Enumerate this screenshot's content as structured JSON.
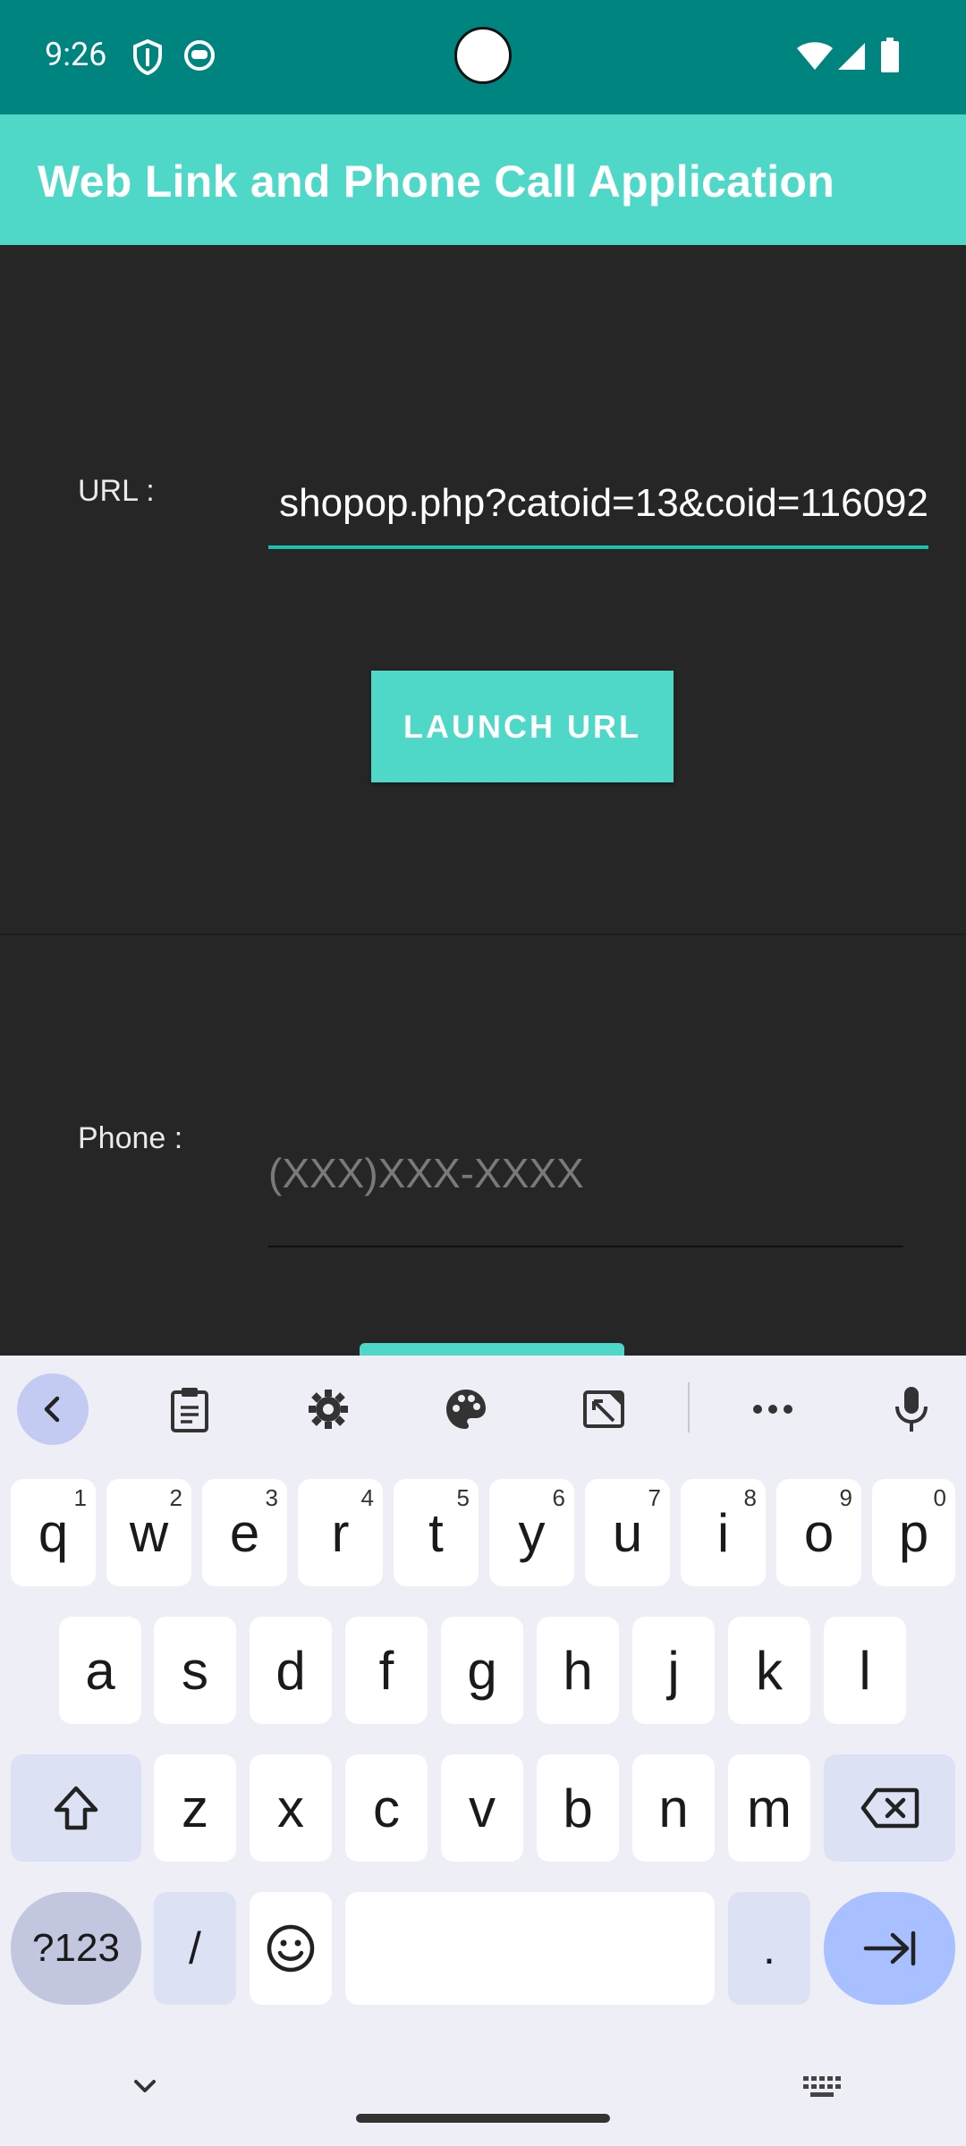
{
  "status_bar": {
    "time": "9:26",
    "icons": [
      "shield-icon",
      "android-face-icon",
      "wifi-icon",
      "signal-icon",
      "battery-icon"
    ]
  },
  "app_bar": {
    "title": "Web Link and Phone Call Application",
    "color": "#4fd8c8"
  },
  "url_section": {
    "label": "URL :",
    "value": "shopop.php?catoid=13&coid=116092",
    "launch_button": "LAUNCH URL"
  },
  "phone_section": {
    "label": "Phone :",
    "placeholder": "(XXX)XXX-XXXX"
  },
  "keyboard": {
    "toolbar": [
      "back-icon",
      "clipboard-icon",
      "settings-icon",
      "palette-icon",
      "edit-icon",
      "more-icon",
      "mic-icon"
    ],
    "row1": [
      {
        "key": "q",
        "hint": "1"
      },
      {
        "key": "w",
        "hint": "2"
      },
      {
        "key": "e",
        "hint": "3"
      },
      {
        "key": "r",
        "hint": "4"
      },
      {
        "key": "t",
        "hint": "5"
      },
      {
        "key": "y",
        "hint": "6"
      },
      {
        "key": "u",
        "hint": "7"
      },
      {
        "key": "i",
        "hint": "8"
      },
      {
        "key": "o",
        "hint": "9"
      },
      {
        "key": "p",
        "hint": "0"
      }
    ],
    "row2": [
      "a",
      "s",
      "d",
      "f",
      "g",
      "h",
      "j",
      "k",
      "l"
    ],
    "row3": [
      "z",
      "x",
      "c",
      "v",
      "b",
      "n",
      "m"
    ],
    "symbols_key": "?123",
    "slash_key": "/",
    "period_key": ".",
    "accent_color": "#a8c0ff"
  }
}
